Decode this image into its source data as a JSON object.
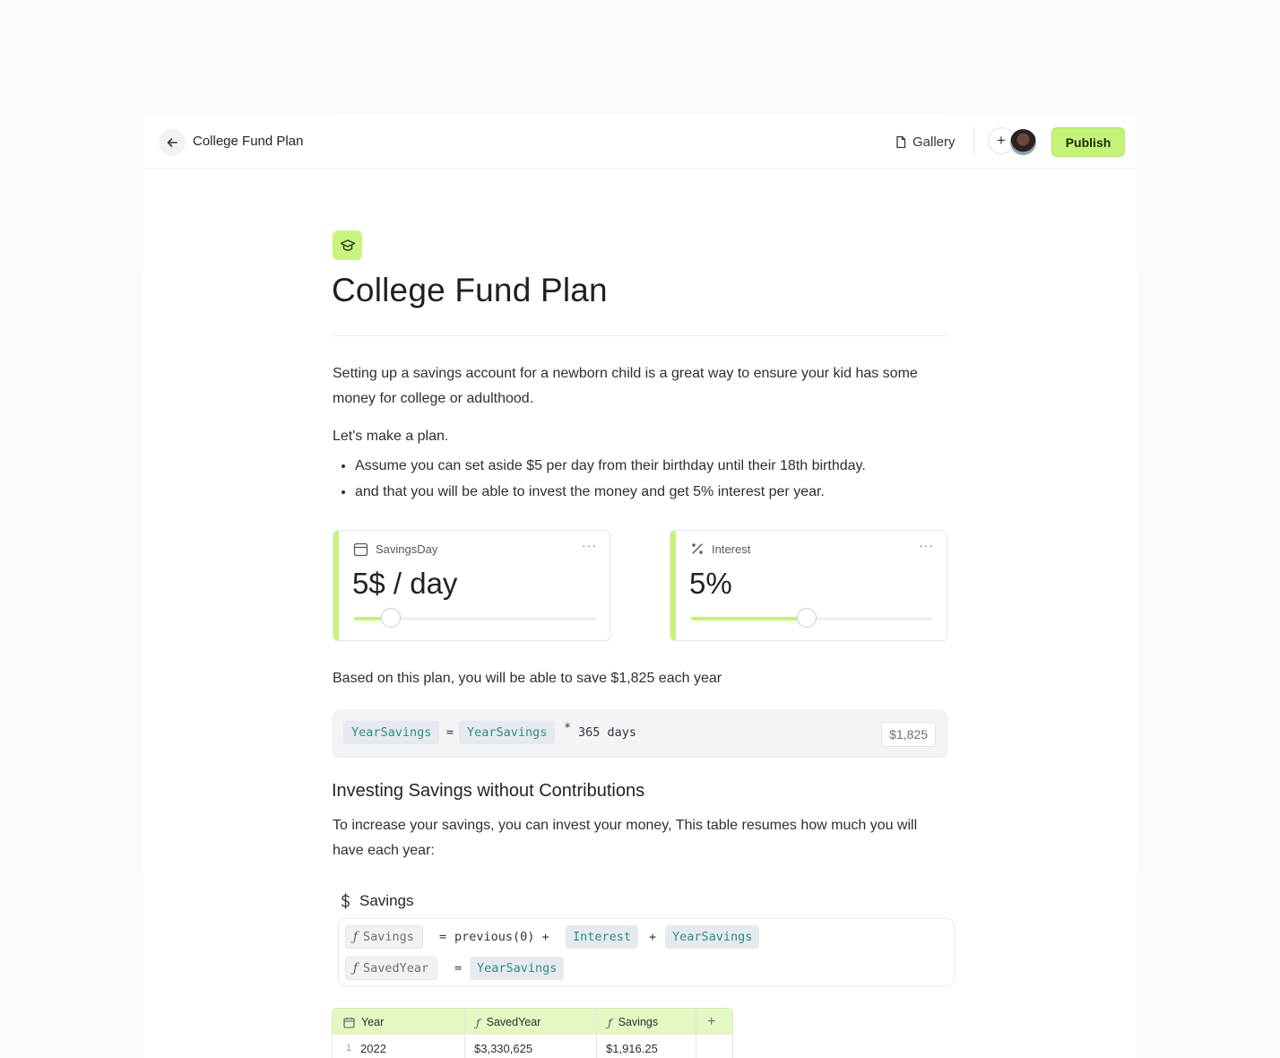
{
  "header": {
    "title": "College Fund Plan",
    "gallery_label": "Gallery",
    "invite_symbol": "+",
    "publish_label": "Publish"
  },
  "doc": {
    "icon": "graduation-cap-icon",
    "title": "College Fund Plan",
    "intro": "Setting up a savings account for a newborn child is a great way to ensure your kid has some money for college or adulthood.",
    "lead": "Let's make a plan.",
    "bullets": [
      "Assume you can set aside $5 per day from their birthday until their 18th birthday.",
      "and that you will be able to invest the money and get 5% interest per year."
    ]
  },
  "widgets": [
    {
      "label": "SavingsDay",
      "icon": "calendar-icon",
      "value": "5$ / day",
      "more": "···",
      "slider_fraction": 0.153
    },
    {
      "label": "Interest",
      "icon": "percent-icon",
      "value": "5%",
      "more": "···",
      "slider_fraction": 0.478
    }
  ],
  "summary": "Based on this plan, you will be able to save $1,825 each year",
  "formula": {
    "lhs": "YearSavings",
    "eq": "=",
    "ref": "YearSavings",
    "op": "*",
    "tail": "365 days",
    "result": "$1,825"
  },
  "section": {
    "title": "Investing Savings without Contributions",
    "text": "To increase your savings, you can invest your money, This table resumes how much you will have each year:"
  },
  "savings_block": {
    "title": "Savings",
    "icon": "dollar-icon",
    "formulas": [
      {
        "name": "Savings",
        "eq": "=",
        "expr_text": "previous(0) +",
        "ref1": "Interest",
        "plus": "+",
        "ref2": "YearSavings"
      },
      {
        "name": "SavedYear",
        "eq": "=",
        "ref1": "YearSavings"
      }
    ]
  },
  "table": {
    "columns": [
      "Year",
      "SavedYear",
      "Savings"
    ],
    "add_symbol": "+",
    "rows": [
      {
        "num": "1",
        "year": "2022",
        "saved": "$3,330,625",
        "savings": "$1,916.25"
      }
    ]
  },
  "colors": {
    "accent": "#c5f37a",
    "formula_ref": "#2a8f86",
    "table_header": "#e3f8c2"
  }
}
